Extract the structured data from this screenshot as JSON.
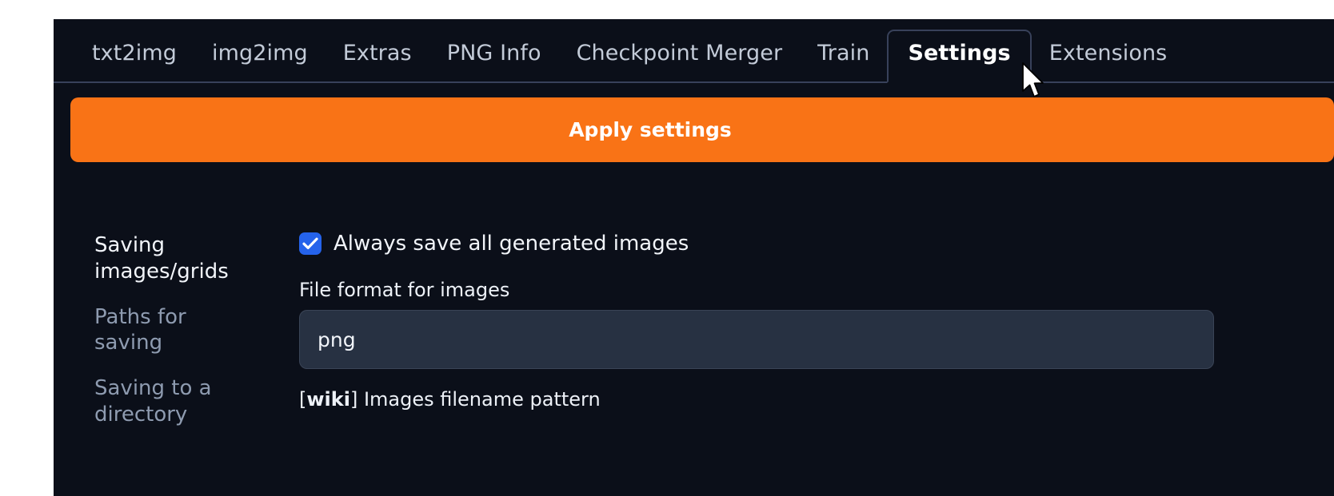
{
  "app": {
    "background_color": "#0b0f19",
    "accent_color": "#f97316",
    "checkbox_color": "#2563eb"
  },
  "tabs": [
    {
      "label": "txt2img",
      "active": false
    },
    {
      "label": "img2img",
      "active": false
    },
    {
      "label": "Extras",
      "active": false
    },
    {
      "label": "PNG Info",
      "active": false
    },
    {
      "label": "Checkpoint Merger",
      "active": false
    },
    {
      "label": "Train",
      "active": false
    },
    {
      "label": "Settings",
      "active": true
    },
    {
      "label": "Extensions",
      "active": false
    }
  ],
  "toolbar": {
    "apply_label": "Apply settings"
  },
  "nav": {
    "items": [
      {
        "label": "Saving images/grids",
        "selected": true
      },
      {
        "label": "Paths for saving",
        "selected": false
      },
      {
        "label": "Saving to a directory",
        "selected": false
      }
    ]
  },
  "fields": {
    "always_save": {
      "label": "Always save all generated images",
      "checked": true,
      "check_glyph": "check-icon"
    },
    "file_format": {
      "label": "File format for images",
      "value": "png",
      "placeholder": ""
    },
    "filename_pattern": {
      "label_prefix": "[",
      "label_link": "wiki",
      "label_suffix": "] Images filename pattern"
    }
  },
  "cursor": {
    "icon": "arrow-pointer-icon"
  }
}
